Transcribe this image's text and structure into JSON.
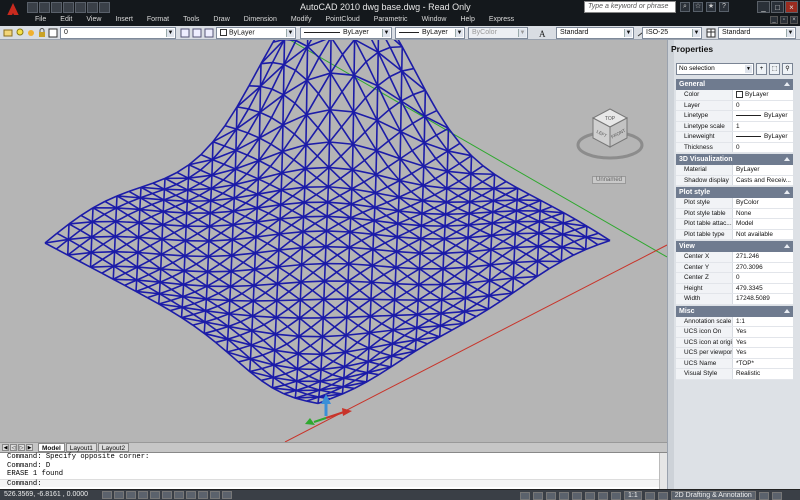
{
  "window": {
    "title": "AutoCAD 2010    dwg base.dwg - Read Only",
    "search_placeholder": "Type a keyword or phrase"
  },
  "menu": {
    "items": [
      "File",
      "Edit",
      "View",
      "Insert",
      "Format",
      "Tools",
      "Draw",
      "Dimension",
      "Modify",
      "PointCloud",
      "Parametric",
      "Window",
      "Help",
      "Express"
    ]
  },
  "toolbar": {
    "layer_value": "0",
    "color_value": "ByLayer",
    "linetype_value": "ByLayer",
    "lineweight_value": "ByLayer",
    "plotstyle_value": "ByColor",
    "text_style": "Standard",
    "dim_style": "ISO-25",
    "table_style": "Standard"
  },
  "viewport": {
    "viewcube_face": "TOP",
    "viewcube_left": "LEFT",
    "viewcube_front": "FRONT",
    "ucs_label": "Unnamed",
    "mesh_color": "#1c1ca8"
  },
  "tabs": [
    {
      "label": "Model",
      "active": true
    },
    {
      "label": "Layout1",
      "active": false
    },
    {
      "label": "Layout2",
      "active": false
    }
  ],
  "command": {
    "lines": [
      "Command: Specify opposite corner:",
      "Command: D",
      "ERASE 1 found"
    ],
    "prompt": "Command:"
  },
  "status": {
    "coords": "526.3569, -6.8161 , 0.0000",
    "scale": "1:1",
    "workspace": "2D Drafting & Annotation"
  },
  "properties": {
    "title": "Properties",
    "selection": "No selection",
    "sections": [
      {
        "name": "General",
        "rows": [
          {
            "k": "Color",
            "v": "ByLayer"
          },
          {
            "k": "Layer",
            "v": "0"
          },
          {
            "k": "Linetype",
            "v": "ByLayer"
          },
          {
            "k": "Linetype scale",
            "v": "1"
          },
          {
            "k": "Lineweight",
            "v": "ByLayer"
          },
          {
            "k": "Thickness",
            "v": "0"
          }
        ]
      },
      {
        "name": "3D Visualization",
        "rows": [
          {
            "k": "Material",
            "v": "ByLayer"
          },
          {
            "k": "Shadow display",
            "v": "Casts and Receiv..."
          }
        ]
      },
      {
        "name": "Plot style",
        "rows": [
          {
            "k": "Plot style",
            "v": "ByColor"
          },
          {
            "k": "Plot style table",
            "v": "None"
          },
          {
            "k": "Plot table attac...",
            "v": "Model"
          },
          {
            "k": "Plot table type",
            "v": "Not available"
          }
        ]
      },
      {
        "name": "View",
        "rows": [
          {
            "k": "Center X",
            "v": "271.246"
          },
          {
            "k": "Center Y",
            "v": "270.3096"
          },
          {
            "k": "Center Z",
            "v": "0"
          },
          {
            "k": "Height",
            "v": "479.3345"
          },
          {
            "k": "Width",
            "v": "17248.5089"
          }
        ]
      },
      {
        "name": "Misc",
        "rows": [
          {
            "k": "Annotation scale",
            "v": "1:1"
          },
          {
            "k": "UCS icon On",
            "v": "Yes"
          },
          {
            "k": "UCS icon at origin",
            "v": "Yes"
          },
          {
            "k": "UCS per viewport",
            "v": "Yes"
          },
          {
            "k": "UCS Name",
            "v": "*TOP*"
          },
          {
            "k": "Visual Style",
            "v": "Realistic"
          }
        ]
      }
    ]
  }
}
